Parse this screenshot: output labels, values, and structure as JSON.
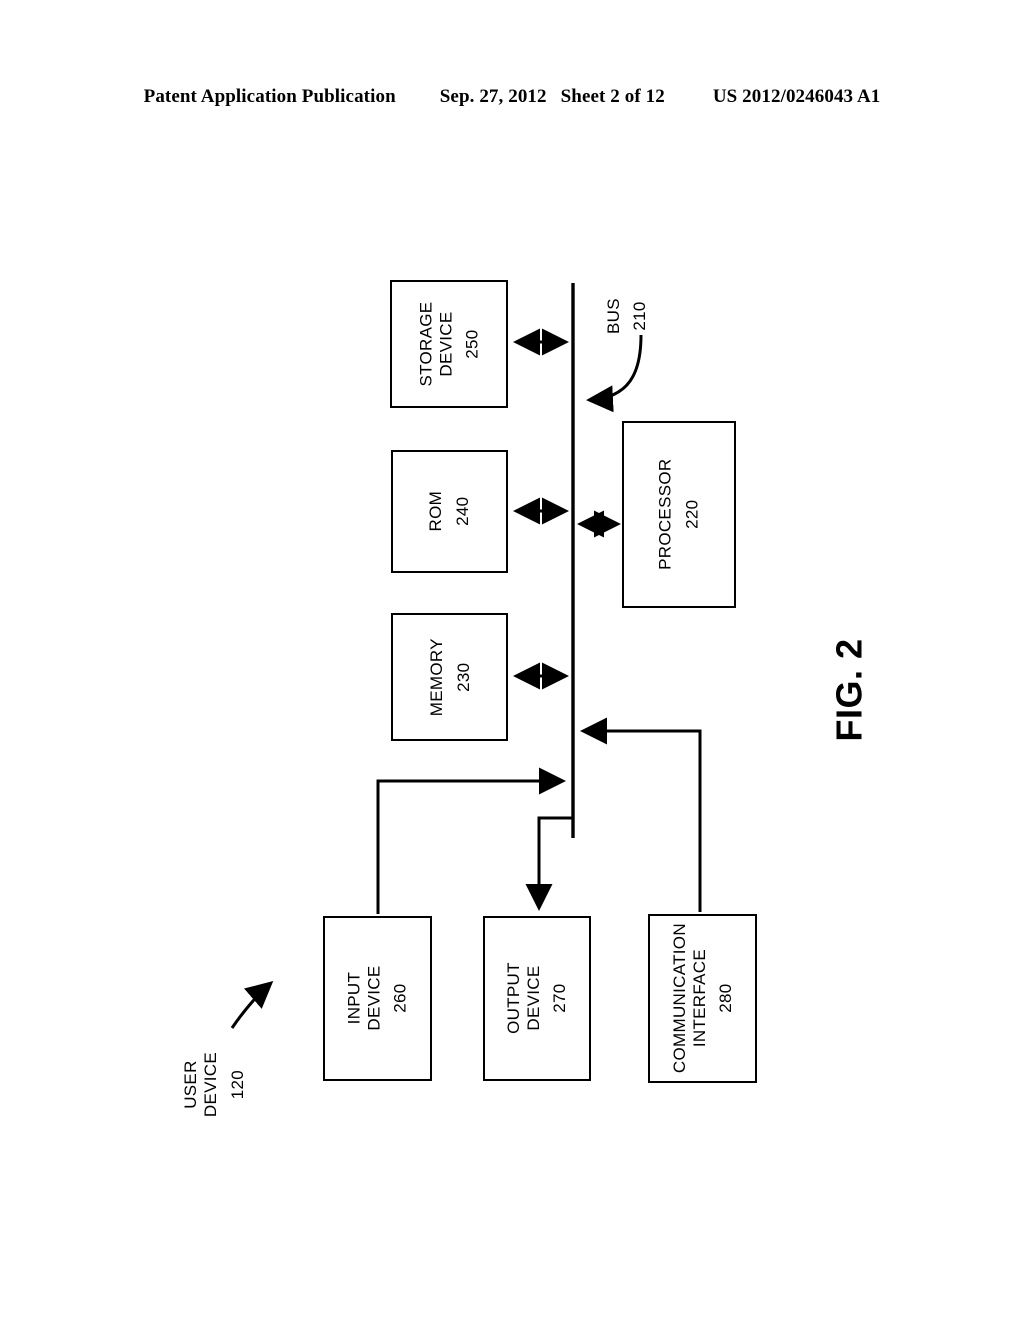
{
  "page_header": {
    "publication": "Patent Application Publication",
    "date": "Sep. 27, 2012",
    "sheet": "Sheet 2 of 12",
    "patent_number": "US 2012/0246043 A1"
  },
  "figure": {
    "caption": "FIG. 2",
    "overall_label": {
      "line1": "USER",
      "line2": "DEVICE",
      "number": "120"
    },
    "bus": {
      "label": "BUS",
      "number": "210"
    },
    "blocks": [
      {
        "id": "storage-device",
        "line1": "STORAGE",
        "line2": "DEVICE",
        "number": "250"
      },
      {
        "id": "rom",
        "line1": "ROM",
        "line2": "",
        "number": "240"
      },
      {
        "id": "memory",
        "line1": "MEMORY",
        "line2": "",
        "number": "230"
      },
      {
        "id": "processor",
        "line1": "PROCESSOR",
        "line2": "",
        "number": "220"
      },
      {
        "id": "input-device",
        "line1": "INPUT",
        "line2": "DEVICE",
        "number": "260"
      },
      {
        "id": "output-device",
        "line1": "OUTPUT",
        "line2": "DEVICE",
        "number": "270"
      },
      {
        "id": "communication-interface",
        "line1": "COMMUNICATION",
        "line2": "INTERFACE",
        "number": "280"
      }
    ]
  },
  "colors": {
    "ink": "#000000",
    "paper": "#ffffff"
  }
}
